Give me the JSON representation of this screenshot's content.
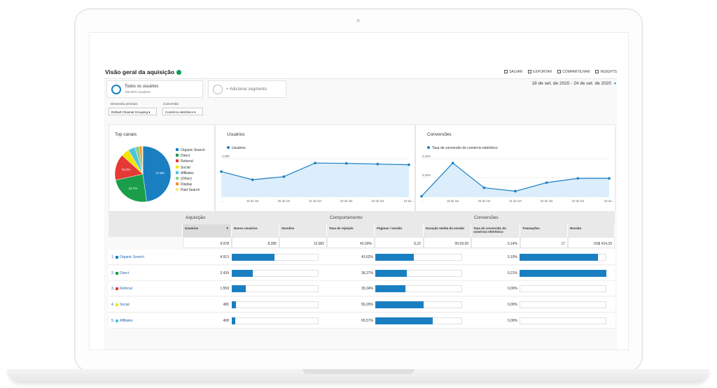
{
  "page": {
    "title": "Visão geral da aquisição",
    "actions": [
      "SALVAR",
      "EXPORTAR",
      "COMPARTILHAR",
      "INSIGHTS"
    ],
    "date_range": "18 de set. de 2020 - 24 de set. de 2020"
  },
  "segments": {
    "primary_label": "Todos os usuários",
    "primary_sub": "100,00% Usuários",
    "add_label": "+ Adicionar segmento"
  },
  "filters": {
    "dimension_label": "Dimensão primária:",
    "dimension_value": "Default Channel Grouping",
    "conversion_label": "Conversão:",
    "conversion_value": "Comércio eletrônico"
  },
  "top_channels": {
    "title": "Top canais",
    "legend": [
      {
        "name": "Organic Search",
        "color": "#1a7fc1"
      },
      {
        "name": "Direct",
        "color": "#1a9e4a"
      },
      {
        "name": "Referral",
        "color": "#e53935"
      },
      {
        "name": "Social",
        "color": "#f2e600"
      },
      {
        "name": "Affiliates",
        "color": "#4fc3e0"
      },
      {
        "name": "(Other)",
        "color": "#8bd18b"
      },
      {
        "name": "Display",
        "color": "#f28c28"
      },
      {
        "name": "Paid Search",
        "color": "#f5e88a"
      }
    ],
    "slices": [
      {
        "name": "Organic Search",
        "value": 47.8,
        "label": "47,8%",
        "color": "#1a7fc1"
      },
      {
        "name": "Direct",
        "value": 23.7,
        "label": "23,7%",
        "color": "#1a9e4a"
      },
      {
        "name": "Referral",
        "value": 15.2,
        "label": "15,2%",
        "color": "#e53935"
      },
      {
        "name": "Social",
        "value": 4.7,
        "label": "",
        "color": "#f2e600"
      },
      {
        "name": "Affiliates",
        "value": 4.0,
        "label": "",
        "color": "#4fc3e0"
      },
      {
        "name": "(Other)",
        "value": 2.5,
        "label": "",
        "color": "#8bd18b"
      },
      {
        "name": "Display",
        "value": 1.5,
        "label": "",
        "color": "#f28c28"
      },
      {
        "name": "Paid Search",
        "value": 0.6,
        "label": "",
        "color": "#f5e88a"
      }
    ]
  },
  "chart_data": [
    {
      "type": "line",
      "title": "Usuários",
      "series": [
        {
          "name": "Usuários",
          "values": [
            1500,
            1020,
            1200,
            2000,
            1980,
            1940,
            1900
          ]
        }
      ],
      "x": [
        "...",
        "19 de set",
        "20 de set",
        "21 de set",
        "22 de set",
        "23 de set",
        "24 de..."
      ],
      "y_ticks": [
        "2.000",
        "1.000"
      ],
      "ylim": [
        0,
        2500
      ]
    },
    {
      "type": "line",
      "title": "Conversões",
      "series": [
        {
          "name": "Taxa de conversão do comércio eletrônico",
          "values": [
            0.01,
            0.4,
            0.11,
            0.07,
            0.17,
            0.22,
            0.22
          ]
        }
      ],
      "x": [
        "...",
        "19 de set",
        "20 de set",
        "21 de set",
        "22 de set",
        "23 de set",
        "24 de..."
      ],
      "y_ticks": [
        "0,40%",
        "0,20%"
      ],
      "ylim": [
        0,
        0.5
      ]
    }
  ],
  "table": {
    "groups": [
      "Aquisição",
      "Comportamento",
      "Conversões"
    ],
    "columns": [
      "Usuários",
      "Novos usuários",
      "Sessões",
      "Taxa de rejeição",
      "Páginas / sessão",
      "Duração média da sessão",
      "Taxa de conversão do comércio eletrônico",
      "Transações",
      "Receita"
    ],
    "sort_arrow": "▼",
    "totals": [
      "9.978",
      "8.285",
      "12.082",
      "42,00%",
      "5,22",
      "00:03:30",
      "0,14%",
      "17",
      "US$ 914,29"
    ],
    "rows": [
      {
        "n": "1",
        "name": "Organic Search",
        "color": "#1a7fc1",
        "users": "4.913",
        "users_pct": 0.49,
        "bounce": "43,62%",
        "bounce_pct": 0.44,
        "conv": "0,19%",
        "conv_pct": 0.9
      },
      {
        "n": "2",
        "name": "Direct",
        "color": "#1a9e4a",
        "users": "2.439",
        "users_pct": 0.24,
        "bounce": "36,27%",
        "bounce_pct": 0.36,
        "conv": "0,21%",
        "conv_pct": 1.0
      },
      {
        "n": "3",
        "name": "Referral",
        "color": "#e53935",
        "users": "1.559",
        "users_pct": 0.16,
        "bounce": "35,04%",
        "bounce_pct": 0.35,
        "conv": "0,00%",
        "conv_pct": 0
      },
      {
        "n": "4",
        "name": "Social",
        "color": "#f2e600",
        "users": "480",
        "users_pct": 0.05,
        "bounce": "56,29%",
        "bounce_pct": 0.56,
        "conv": "0,00%",
        "conv_pct": 0
      },
      {
        "n": "5",
        "name": "Affiliates",
        "color": "#4fc3e0",
        "users": "408",
        "users_pct": 0.04,
        "bounce": "65,57%",
        "bounce_pct": 0.66,
        "conv": "0,00%",
        "conv_pct": 0
      }
    ]
  }
}
